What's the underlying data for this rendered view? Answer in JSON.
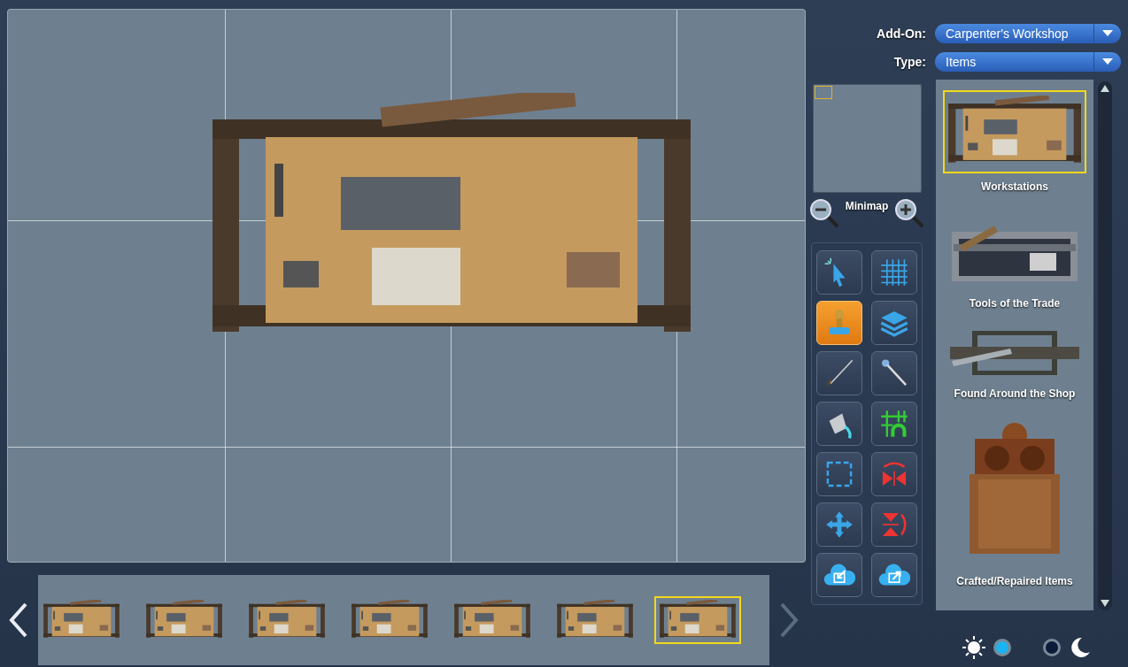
{
  "addon": {
    "label": "Add-On:",
    "value": "Carpenter's Workshop"
  },
  "type": {
    "label": "Type:",
    "value": "Items"
  },
  "minimap": {
    "label": "Minimap"
  },
  "tools": [
    {
      "kind": "select",
      "selected": false
    },
    {
      "kind": "grid",
      "selected": false
    },
    {
      "kind": "stamp",
      "selected": true
    },
    {
      "kind": "layers",
      "selected": false
    },
    {
      "kind": "brush",
      "selected": false
    },
    {
      "kind": "wand",
      "selected": false
    },
    {
      "kind": "fill",
      "selected": false
    },
    {
      "kind": "snap",
      "selected": false
    },
    {
      "kind": "marquee",
      "selected": false
    },
    {
      "kind": "flip-h",
      "selected": false
    },
    {
      "kind": "move",
      "selected": false
    },
    {
      "kind": "flip-v",
      "selected": false
    },
    {
      "kind": "import",
      "selected": false
    },
    {
      "kind": "export",
      "selected": false
    }
  ],
  "categories": [
    {
      "kind": "workbench",
      "label": "Workstations",
      "selected": true
    },
    {
      "kind": "toolbox",
      "label": "Tools of the Trade",
      "selected": false
    },
    {
      "kind": "plank",
      "label": "Found Around the Shop",
      "selected": false
    },
    {
      "kind": "cabinet",
      "label": "Crafted/Repaired Items",
      "selected": false
    }
  ],
  "strip": [
    {
      "selected": false
    },
    {
      "selected": false
    },
    {
      "selected": false
    },
    {
      "selected": false
    },
    {
      "selected": false
    },
    {
      "selected": false
    },
    {
      "selected": true
    }
  ],
  "theme": [
    {
      "kind": "day",
      "selected": true
    },
    {
      "kind": "night",
      "selected": false
    }
  ]
}
